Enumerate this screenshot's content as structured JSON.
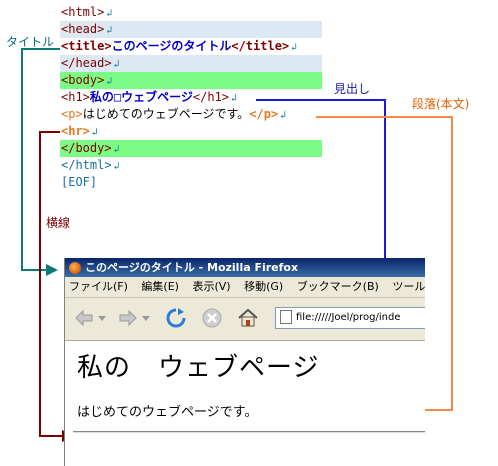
{
  "code": {
    "lines": [
      {
        "a": "<html>"
      },
      {
        "a": "<head>"
      },
      {
        "a": "<title>",
        "b": "このページのタイトル",
        "c": "</title>"
      },
      {
        "a": "</head>"
      },
      {
        "a": "<body>"
      },
      {
        "a": "<h1>",
        "b": "私の□ウェブページ",
        "c": "</h1>"
      },
      {
        "a": "<p>",
        "b": "はじめてのウェブページです。",
        "c": "</p>"
      },
      {
        "a": "<hr>"
      },
      {
        "a": "</body>"
      },
      {
        "a": "</html>"
      },
      {
        "a": "[EOF]"
      }
    ],
    "newline_mark": "↲"
  },
  "annotations": {
    "title": "タイトル",
    "heading": "見出し",
    "paragraph": "段落(本文)",
    "hr": "横線"
  },
  "browser": {
    "window_title": "このページのタイトル - Mozilla Firefox",
    "menu": [
      "ファイル(F)",
      "編集(E)",
      "表示(V)",
      "移動(G)",
      "ブックマーク(B)",
      "ツール("
    ],
    "url": "file://///Joel/prog/inde",
    "page_heading": "私の　ウェブページ",
    "page_paragraph": "はじめてのウェブページです。"
  },
  "colors": {
    "title_arrow": "#0b7a73",
    "heading_arrow": "#1a1ae0",
    "paragraph_arrow": "#f28a4a",
    "hr_arrow": "#7a0000",
    "body_highlight": "#7cfc84",
    "head_highlight": "#dce9f2"
  }
}
